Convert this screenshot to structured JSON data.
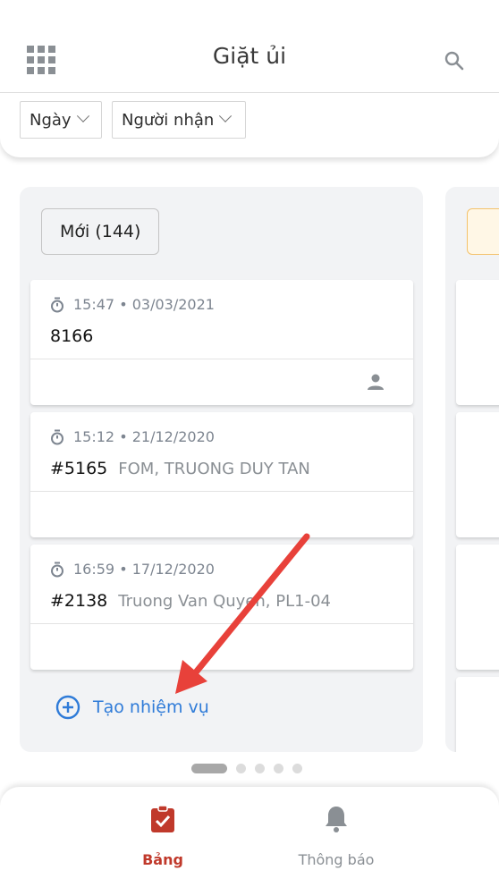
{
  "header": {
    "title": "Giặt ủi",
    "filters": [
      {
        "label": "Ngày"
      },
      {
        "label": "Người nhận"
      }
    ]
  },
  "column": {
    "status_label": "Mới (144)",
    "cards": [
      {
        "time": "15:47 • 03/03/2021",
        "id": "8166",
        "desc": "",
        "assignee": true
      },
      {
        "time": "15:12 • 21/12/2020",
        "id": "#5165",
        "desc": "FOM, TRUONG DUY TAN",
        "assignee": false
      },
      {
        "time": "16:59 • 17/12/2020",
        "id": "#2138",
        "desc": "Truong Van Quyen, PL1-04",
        "assignee": false
      }
    ],
    "create_label": "Tạo nhiệm vụ"
  },
  "pagination": {
    "total": 5,
    "active": 0
  },
  "bottom_nav": {
    "board_label": "Bảng",
    "notify_label": "Thông báo"
  },
  "colors": {
    "accent": "#c0392b",
    "link": "#2f7bd8",
    "column_bg": "#f2f3f5",
    "annotation_arrow": "#e8413a"
  },
  "icons": [
    "apps-grid-icon",
    "search-icon",
    "chevron-down-icon",
    "timer-icon",
    "user-icon",
    "plus-circle-icon",
    "clipboard-check-icon",
    "bell-icon"
  ]
}
